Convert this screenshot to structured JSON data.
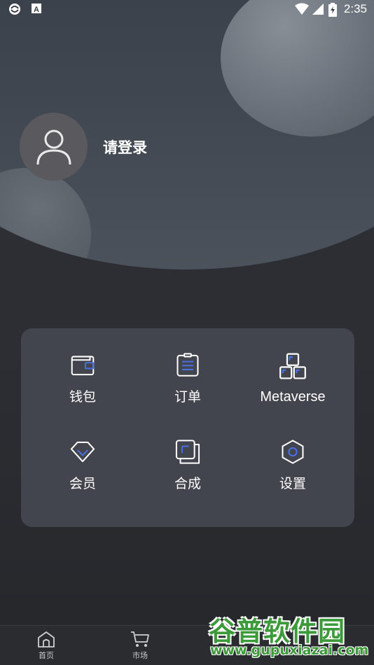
{
  "status_bar": {
    "time": "2:35",
    "icons": [
      "sync-icon",
      "a-badge-icon",
      "wifi-icon",
      "signal-icon",
      "battery-charging-icon"
    ]
  },
  "profile": {
    "login_label": "请登录",
    "avatar_icon": "user-icon"
  },
  "menu": {
    "items": [
      {
        "label": "钱包",
        "icon": "wallet-icon"
      },
      {
        "label": "订单",
        "icon": "order-icon"
      },
      {
        "label": "Metaverse",
        "icon": "cubes-icon"
      },
      {
        "label": "会员",
        "icon": "diamond-icon"
      },
      {
        "label": "合成",
        "icon": "layers-icon"
      },
      {
        "label": "设置",
        "icon": "settings-hexagon-icon"
      }
    ]
  },
  "bottom_nav": {
    "items": [
      {
        "label": "首页",
        "icon": "home-icon"
      },
      {
        "label": "市场",
        "icon": "cart-icon"
      }
    ]
  },
  "watermark": {
    "title": "谷普软件园",
    "url": "www.gupuxiazai.com"
  },
  "colors": {
    "accent": "#4a6fe0",
    "card": "#42454d",
    "watermark_green": "#3d9a3a"
  }
}
